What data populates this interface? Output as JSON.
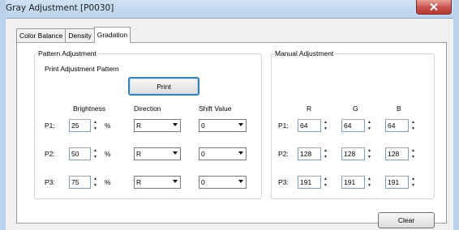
{
  "window": {
    "title": "Gray Adjustment [P0030]"
  },
  "tabs": [
    {
      "label": "Color Balance"
    },
    {
      "label": "Density"
    },
    {
      "label": "Gradation"
    }
  ],
  "pattern": {
    "group_title": "Pattern Adjustment",
    "print_label": "Print Adjustment Pattern",
    "print_button": "Print",
    "headers": {
      "brightness": "Brightness",
      "direction": "Direction",
      "shift": "Shift Value"
    },
    "unit": "%",
    "rows": [
      {
        "label": "P1:",
        "brightness": "25",
        "direction": "R",
        "shift": "0"
      },
      {
        "label": "P2:",
        "brightness": "50",
        "direction": "R",
        "shift": "0"
      },
      {
        "label": "P3:",
        "brightness": "75",
        "direction": "R",
        "shift": "0"
      }
    ]
  },
  "manual": {
    "group_title": "Manual Adjustment",
    "headers": {
      "r": "R",
      "g": "G",
      "b": "B"
    },
    "rows": [
      {
        "label": "P1:",
        "r": "64",
        "g": "64",
        "b": "64"
      },
      {
        "label": "P2:",
        "r": "128",
        "g": "128",
        "b": "128"
      },
      {
        "label": "P3:",
        "r": "191",
        "g": "191",
        "b": "191"
      }
    ],
    "clear_button": "Clear"
  },
  "icons": {
    "close": "close-icon",
    "spin_up": "spin-up-icon",
    "spin_down": "spin-down-icon",
    "dropdown": "chevron-down-icon"
  },
  "colors": {
    "frame": "#b9d1ea",
    "close_button": "#c75050",
    "focus_ring": "#3c7fb1"
  }
}
